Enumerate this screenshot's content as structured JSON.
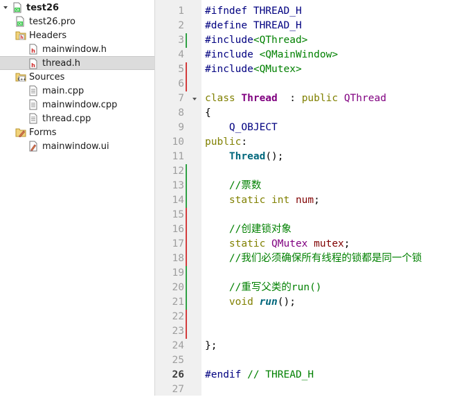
{
  "project_tree": {
    "items": [
      {
        "label": "test26",
        "level": 0,
        "expanded": true,
        "icon": "qt-project-icon",
        "bold": true
      },
      {
        "label": "test26.pro",
        "level": 1,
        "icon": "pro-file-icon"
      },
      {
        "label": "Headers",
        "level": 1,
        "expanded": true,
        "icon": "header-folder-icon"
      },
      {
        "label": "mainwindow.h",
        "level": 2,
        "icon": "header-file-icon"
      },
      {
        "label": "thread.h",
        "level": 2,
        "icon": "header-file-icon",
        "selected": true
      },
      {
        "label": "Sources",
        "level": 1,
        "expanded": true,
        "icon": "source-folder-icon"
      },
      {
        "label": "main.cpp",
        "level": 2,
        "icon": "cpp-file-icon"
      },
      {
        "label": "mainwindow.cpp",
        "level": 2,
        "icon": "cpp-file-icon"
      },
      {
        "label": "thread.cpp",
        "level": 2,
        "icon": "cpp-file-icon"
      },
      {
        "label": "Forms",
        "level": 1,
        "expanded": true,
        "icon": "forms-folder-icon"
      },
      {
        "label": "mainwindow.ui",
        "level": 2,
        "icon": "ui-file-icon"
      }
    ]
  },
  "editor": {
    "current_line": 26,
    "colors": {
      "added": "#2ea043",
      "removed": "#d33b3b",
      "gutter": "#f0f0f0"
    },
    "lines": [
      {
        "n": "1",
        "mark": "",
        "fold": false,
        "tokens": [
          [
            "pp",
            "#ifndef THREAD_H"
          ]
        ]
      },
      {
        "n": "2",
        "mark": "",
        "fold": false,
        "tokens": [
          [
            "pp",
            "#define THREAD_H"
          ]
        ]
      },
      {
        "n": "3",
        "mark": "g",
        "fold": false,
        "tokens": [
          [
            "pp",
            "#include"
          ],
          [
            "str",
            "<QThread>"
          ]
        ]
      },
      {
        "n": "4",
        "mark": "",
        "fold": false,
        "tokens": [
          [
            "pp",
            "#include "
          ],
          [
            "str",
            "<QMainWindow>"
          ]
        ]
      },
      {
        "n": "5",
        "mark": "r",
        "fold": false,
        "tokens": [
          [
            "pp",
            "#include"
          ],
          [
            "str",
            "<QMutex>"
          ]
        ]
      },
      {
        "n": "6",
        "mark": "r",
        "fold": false,
        "tokens": []
      },
      {
        "n": "7",
        "mark": "",
        "fold": true,
        "tokens": [
          [
            "kw",
            "class "
          ],
          [
            "cls",
            "Thread"
          ],
          [
            "",
            "  : "
          ],
          [
            "kw",
            "public "
          ],
          [
            "type",
            "QThread"
          ]
        ]
      },
      {
        "n": "8",
        "mark": "",
        "fold": false,
        "tokens": [
          [
            "",
            "{"
          ]
        ]
      },
      {
        "n": "9",
        "mark": "",
        "fold": false,
        "tokens": [
          [
            "",
            "    "
          ],
          [
            "pp",
            "Q_OBJECT"
          ]
        ]
      },
      {
        "n": "10",
        "mark": "",
        "fold": false,
        "tokens": [
          [
            "kw",
            "public"
          ],
          [
            "",
            ":"
          ]
        ]
      },
      {
        "n": "11",
        "mark": "",
        "fold": false,
        "tokens": [
          [
            "",
            "    "
          ],
          [
            "fn",
            "Thread"
          ],
          [
            "",
            "();"
          ]
        ]
      },
      {
        "n": "12",
        "mark": "g",
        "fold": false,
        "tokens": []
      },
      {
        "n": "13",
        "mark": "g",
        "fold": false,
        "tokens": [
          [
            "",
            "    "
          ],
          [
            "com",
            "//"
          ],
          [
            "comcjk",
            "票数"
          ]
        ]
      },
      {
        "n": "14",
        "mark": "g",
        "fold": false,
        "tokens": [
          [
            "",
            "    "
          ],
          [
            "kw",
            "static int "
          ],
          [
            "mem",
            "num"
          ],
          [
            "",
            ";"
          ]
        ]
      },
      {
        "n": "15",
        "mark": "r",
        "fold": false,
        "tokens": []
      },
      {
        "n": "16",
        "mark": "r",
        "fold": false,
        "tokens": [
          [
            "",
            "    "
          ],
          [
            "com",
            "//"
          ],
          [
            "comcjk",
            "创建锁对象"
          ]
        ]
      },
      {
        "n": "17",
        "mark": "r",
        "fold": false,
        "tokens": [
          [
            "",
            "    "
          ],
          [
            "kw",
            "static "
          ],
          [
            "type",
            "QMutex "
          ],
          [
            "mem",
            "mutex"
          ],
          [
            "",
            ";"
          ]
        ]
      },
      {
        "n": "18",
        "mark": "r",
        "fold": false,
        "tokens": [
          [
            "",
            "    "
          ],
          [
            "com",
            "//"
          ],
          [
            "comcjk",
            "我们必须确保所有线程的锁都是同一个锁"
          ]
        ]
      },
      {
        "n": "19",
        "mark": "g",
        "fold": false,
        "tokens": []
      },
      {
        "n": "20",
        "mark": "g",
        "fold": false,
        "tokens": [
          [
            "",
            "    "
          ],
          [
            "com",
            "//"
          ],
          [
            "comcjk",
            "重写父类的"
          ],
          [
            "com",
            "run()"
          ]
        ]
      },
      {
        "n": "21",
        "mark": "g",
        "fold": false,
        "tokens": [
          [
            "",
            "    "
          ],
          [
            "kw",
            "void "
          ],
          [
            "fnit",
            "run"
          ],
          [
            "",
            "();"
          ]
        ]
      },
      {
        "n": "22",
        "mark": "r",
        "fold": false,
        "tokens": []
      },
      {
        "n": "23",
        "mark": "r",
        "fold": false,
        "tokens": []
      },
      {
        "n": "24",
        "mark": "",
        "fold": false,
        "tokens": [
          [
            "",
            "};"
          ]
        ]
      },
      {
        "n": "25",
        "mark": "",
        "fold": false,
        "tokens": []
      },
      {
        "n": "26",
        "mark": "",
        "fold": false,
        "tokens": [
          [
            "pp",
            "#endif "
          ],
          [
            "com",
            "// THREAD_H"
          ]
        ]
      },
      {
        "n": "27",
        "mark": "",
        "fold": false,
        "tokens": []
      }
    ]
  }
}
